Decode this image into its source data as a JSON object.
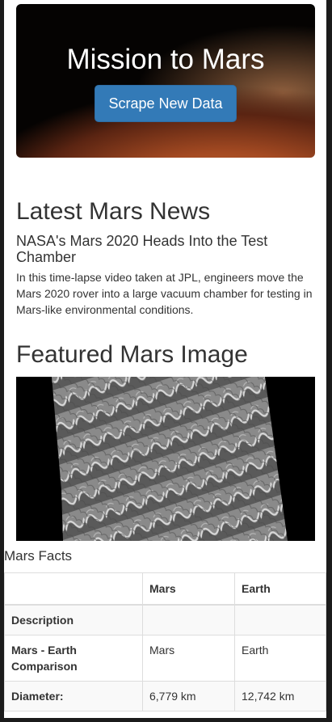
{
  "hero": {
    "title": "Mission to Mars",
    "button_label": "Scrape New Data"
  },
  "news": {
    "heading": "Latest Mars News",
    "title": "NASA's Mars 2020 Heads Into the Test Chamber",
    "body": "In this time-lapse video taken at JPL, engineers move the Mars 2020 rover into a large vacuum chamber for testing in Mars-like environmental conditions."
  },
  "featured_image": {
    "heading": "Featured Mars Image"
  },
  "facts": {
    "caption": "Mars Facts",
    "headers": [
      "",
      "Mars",
      "Earth"
    ],
    "rows": [
      {
        "label": "Description",
        "mars": "",
        "earth": ""
      },
      {
        "label": "Mars - Earth Comparison",
        "mars": "Mars",
        "earth": "Earth"
      },
      {
        "label": "Diameter:",
        "mars": "6,779 km",
        "earth": "12,742 km"
      }
    ]
  }
}
